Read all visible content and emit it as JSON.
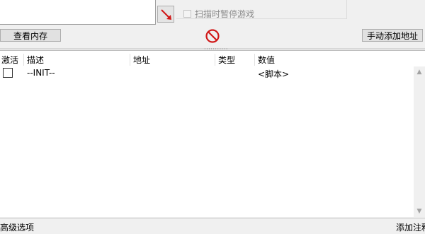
{
  "scan_panel": {
    "pause_label": "扫描时暂停游戏",
    "pause_checked": false
  },
  "toolbar": {
    "view_memory_label": "查看内存",
    "add_address_label": "手动添加地址"
  },
  "table": {
    "columns": [
      "激活",
      "描述",
      "地址",
      "类型",
      "数值"
    ],
    "rows": [
      {
        "active": false,
        "description": "--INIT--",
        "address": "",
        "type": "",
        "value": "<脚本>"
      }
    ]
  },
  "footer": {
    "advanced_label": "高级选项",
    "comment_label": "添加注释"
  }
}
